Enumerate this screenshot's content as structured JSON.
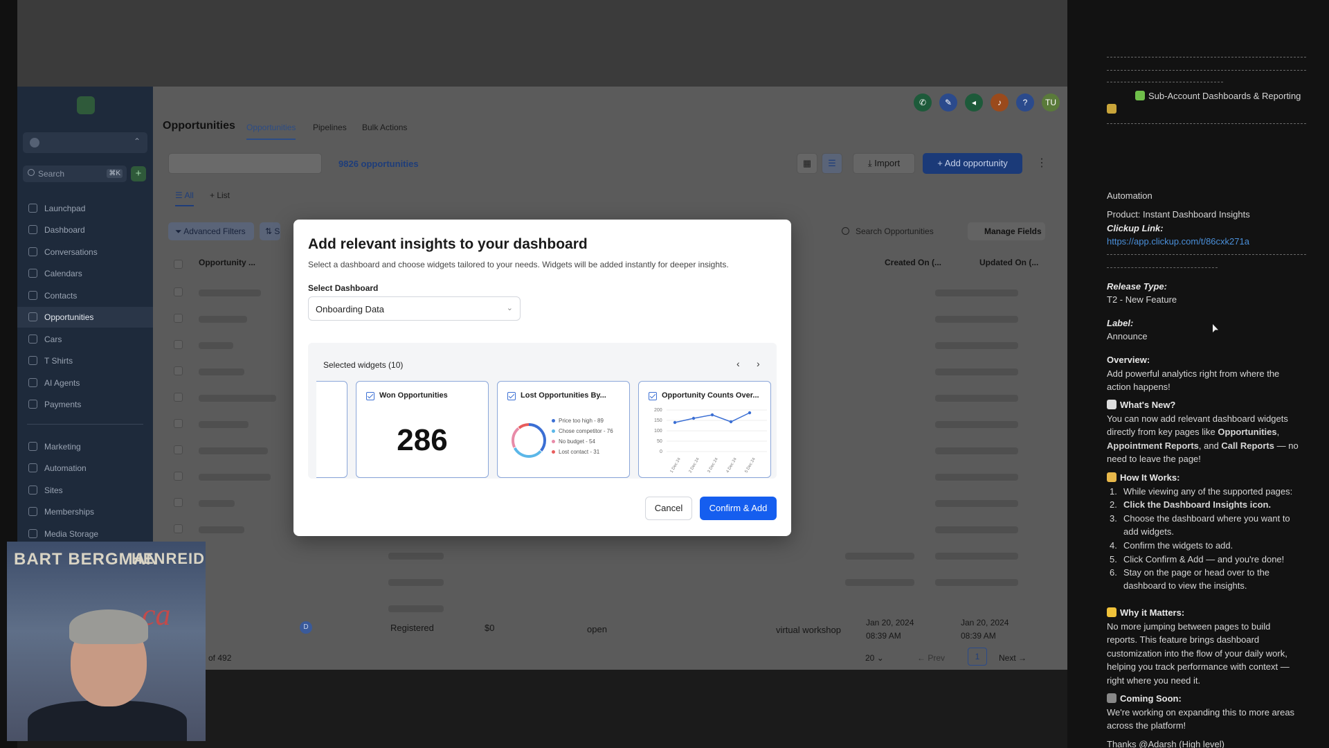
{
  "sidebar": {
    "search_placeholder": "Search",
    "search_kbd": "⌘K",
    "items": [
      {
        "label": "Launchpad"
      },
      {
        "label": "Dashboard"
      },
      {
        "label": "Conversations"
      },
      {
        "label": "Calendars"
      },
      {
        "label": "Contacts"
      },
      {
        "label": "Opportunities"
      },
      {
        "label": "Cars"
      },
      {
        "label": "T Shirts"
      },
      {
        "label": "AI Agents"
      },
      {
        "label": "Payments"
      },
      {
        "label": "Marketing"
      },
      {
        "label": "Automation"
      },
      {
        "label": "Sites"
      },
      {
        "label": "Memberships"
      },
      {
        "label": "Media Storage"
      }
    ]
  },
  "header": {
    "title": "Opportunities",
    "tabs": [
      "Opportunities",
      "Pipelines",
      "Bulk Actions"
    ],
    "avatar_initials": "TU",
    "help_label": "?"
  },
  "toolbar": {
    "count": "9826 opportunities",
    "import_label": "Import",
    "add_label": "Add opportunity"
  },
  "subtabs": {
    "all": "All",
    "list": "List"
  },
  "filters": {
    "advanced": "Advanced Filters",
    "sort_short": "S",
    "search_placeholder": "Search Opportunities",
    "manage_fields": "Manage Fields"
  },
  "table": {
    "headers": {
      "opportunity": "Opportunity ...",
      "created": "Created On (...",
      "updated": "Updated On (..."
    },
    "last_row": {
      "avatar": "D",
      "status": "Registered",
      "value": "$0",
      "state": "open",
      "source": "virtual workshop",
      "created_date": "Jan 20, 2024",
      "created_time": "08:39 AM",
      "updated_date": "Jan 20, 2024",
      "updated_time": "08:39 AM"
    }
  },
  "pager": {
    "of_total": "of 492",
    "page_size": "20",
    "prev": "Prev",
    "page": "1",
    "next": "Next"
  },
  "modal": {
    "title": "Add relevant insights to your dashboard",
    "subtitle": "Select a dashboard and choose widgets tailored to your needs. Widgets will be added instantly for deeper insights.",
    "select_label": "Select Dashboard",
    "select_value": "Onboarding Data",
    "widgets_title": "Selected widgets (10)",
    "widgets": [
      {
        "title": "Won Opportunities",
        "value": "286"
      },
      {
        "title": "Lost Opportunities By...",
        "legend": [
          "Price too high - 89",
          "Chose competitor - 76",
          "No budget - 54",
          "Lost contact - 31"
        ]
      },
      {
        "title": "Opportunity Counts Over...",
        "y_ticks": [
          "200",
          "150",
          "100",
          "50",
          "0"
        ],
        "x_ticks": [
          "1 Dec 24",
          "2 Dec 24",
          "3 Dec 24",
          "4 Dec 24",
          "5 Dec 24"
        ]
      }
    ],
    "cancel": "Cancel",
    "confirm": "Confirm & Add"
  },
  "webcam": {
    "poster_text": "BART BERGMAN",
    "poster_text2": "HENREID",
    "poster_script": "ca"
  },
  "right_panel": {
    "heading": "Sub-Account Dashboards & Reporting",
    "automation": "Automation",
    "product_label": "Product:",
    "product_value": "Instant Dashboard Insights",
    "clickup_label": "Clickup Link:",
    "clickup_url": "https://app.clickup.com/t/86cxk271a",
    "release_label": "Release Type:",
    "release_value": "T2 - New Feature",
    "label_label": "Label:",
    "label_value": "Announce",
    "overview_label": "Overview:",
    "overview_1": "Add powerful analytics right from where the",
    "overview_2": "action happens!",
    "whats_new": "What's New?",
    "new_1": "You can now add relevant dashboard widgets",
    "new_2a": "directly from key pages like ",
    "new_2b": "Opportunities",
    "new_2c": ",",
    "new_3a": "Appointment Reports",
    "new_3b": ", and ",
    "new_3c": "Call Reports",
    "new_3d": " — no",
    "new_4": "need to leave the page!",
    "how_label": "How It Works:",
    "steps": [
      "While viewing any of the supported pages:",
      "Click the Dashboard Insights icon.",
      "Choose the dashboard where you want to",
      "add widgets.",
      "Confirm the widgets to add.",
      "Click Confirm & Add — and you're done!",
      "Stay on the page or head over to the",
      "dashboard to view the insights."
    ],
    "why_label": "Why it Matters:",
    "why_1": "No more jumping between pages to build",
    "why_2": "reports. This feature brings dashboard",
    "why_3": "customization into the flow of your daily work,",
    "why_4": "helping you track performance with context —",
    "why_5": "right where you need it.",
    "soon_label": "Coming Soon:",
    "soon_1": "We're working on expanding this to more areas",
    "soon_2": "across the platform!",
    "thanks": "Thanks ",
    "thanks_mention": "@Adarsh (High level)"
  },
  "colors": {
    "primary": "#155eef",
    "sidebar": "#1e2a3b",
    "panel": "#121212",
    "link": "#4a8fd9"
  }
}
